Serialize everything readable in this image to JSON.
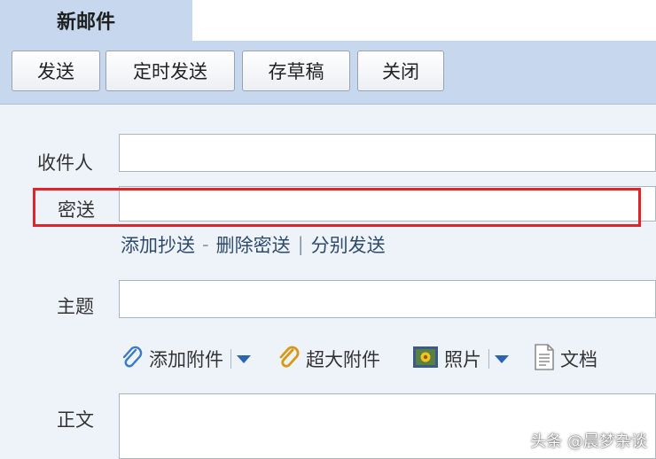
{
  "tab": {
    "title": "新邮件"
  },
  "toolbar": {
    "send": "发送",
    "scheduled_send": "定时发送",
    "save_draft": "存草稿",
    "close": "关闭"
  },
  "form": {
    "to_label": "收件人",
    "bcc_label": "密送",
    "links": {
      "add_cc": "添加抄送",
      "dash": "-",
      "remove_bcc": "删除密送",
      "bar": "|",
      "separate_send": "分别发送"
    },
    "subject_label": "主题",
    "body_label": "正文"
  },
  "attachments": {
    "add_attachment": "添加附件",
    "large_attachment": "超大附件",
    "photo": "照片",
    "document": "文档"
  },
  "highlight_color": "#e1232a",
  "watermark": "头条 @晨梦杂谈"
}
